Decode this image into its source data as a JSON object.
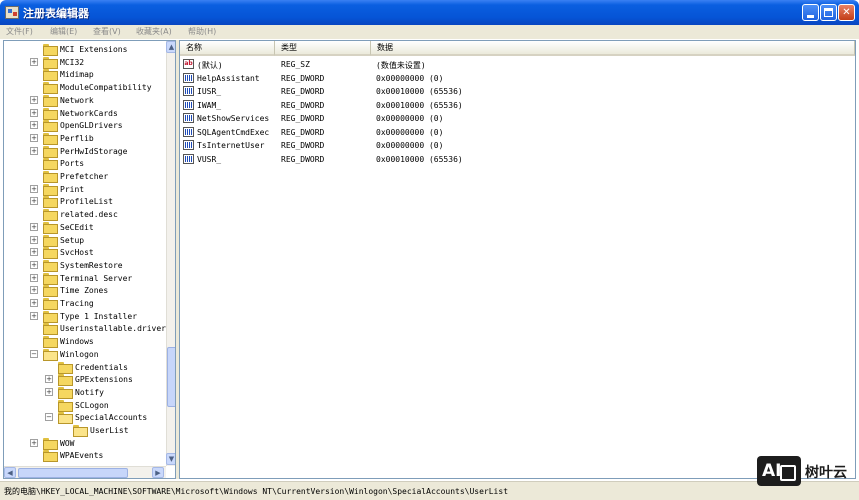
{
  "window": {
    "title": "注册表编辑器",
    "minimize_label": "",
    "maximize_label": "",
    "close_label": "✕"
  },
  "menu": [
    "文件(F)",
    "编辑(E)",
    "查看(V)",
    "收藏夹(A)",
    "帮助(H)"
  ],
  "tree": {
    "items": [
      {
        "label": "MCI Extensions",
        "depth": 0,
        "expander": "",
        "open": false
      },
      {
        "label": "MCI32",
        "depth": 0,
        "expander": "+",
        "open": false
      },
      {
        "label": "Midimap",
        "depth": 0,
        "expander": "",
        "open": false
      },
      {
        "label": "ModuleCompatibility",
        "depth": 0,
        "expander": "",
        "open": false
      },
      {
        "label": "Network",
        "depth": 0,
        "expander": "+",
        "open": false
      },
      {
        "label": "NetworkCards",
        "depth": 0,
        "expander": "+",
        "open": false
      },
      {
        "label": "OpenGLDrivers",
        "depth": 0,
        "expander": "+",
        "open": false
      },
      {
        "label": "Perflib",
        "depth": 0,
        "expander": "+",
        "open": false
      },
      {
        "label": "PerHwIdStorage",
        "depth": 0,
        "expander": "+",
        "open": false
      },
      {
        "label": "Ports",
        "depth": 0,
        "expander": "",
        "open": false
      },
      {
        "label": "Prefetcher",
        "depth": 0,
        "expander": "",
        "open": false
      },
      {
        "label": "Print",
        "depth": 0,
        "expander": "+",
        "open": false
      },
      {
        "label": "ProfileList",
        "depth": 0,
        "expander": "+",
        "open": false
      },
      {
        "label": "related.desc",
        "depth": 0,
        "expander": "",
        "open": false
      },
      {
        "label": "SeCEdit",
        "depth": 0,
        "expander": "+",
        "open": false
      },
      {
        "label": "Setup",
        "depth": 0,
        "expander": "+",
        "open": false
      },
      {
        "label": "SvcHost",
        "depth": 0,
        "expander": "+",
        "open": false
      },
      {
        "label": "SystemRestore",
        "depth": 0,
        "expander": "+",
        "open": false
      },
      {
        "label": "Terminal Server",
        "depth": 0,
        "expander": "+",
        "open": false
      },
      {
        "label": "Time Zones",
        "depth": 0,
        "expander": "+",
        "open": false
      },
      {
        "label": "Tracing",
        "depth": 0,
        "expander": "+",
        "open": false
      },
      {
        "label": "Type 1 Installer",
        "depth": 0,
        "expander": "+",
        "open": false
      },
      {
        "label": "Userinstallable.drivers",
        "depth": 0,
        "expander": "",
        "open": false
      },
      {
        "label": "Windows",
        "depth": 0,
        "expander": "",
        "open": false
      },
      {
        "label": "Winlogon",
        "depth": 0,
        "expander": "−",
        "open": true
      },
      {
        "label": "Credentials",
        "depth": 1,
        "expander": "",
        "open": false
      },
      {
        "label": "GPExtensions",
        "depth": 1,
        "expander": "+",
        "open": false
      },
      {
        "label": "Notify",
        "depth": 1,
        "expander": "+",
        "open": false
      },
      {
        "label": "SCLogon",
        "depth": 1,
        "expander": "",
        "open": false
      },
      {
        "label": "SpecialAccounts",
        "depth": 1,
        "expander": "−",
        "open": true
      },
      {
        "label": "UserList",
        "depth": 2,
        "expander": "",
        "open": true
      },
      {
        "label": "WOW",
        "depth": 0,
        "expander": "+",
        "open": false
      },
      {
        "label": "WPAEvents",
        "depth": 0,
        "expander": "",
        "open": false
      }
    ]
  },
  "list": {
    "columns": [
      "名称",
      "类型",
      "数据"
    ],
    "rows": [
      {
        "icon": "string-value-icon",
        "name": "(默认)",
        "type": "REG_SZ",
        "data": "(数值未设置)"
      },
      {
        "icon": "binary-value-icon",
        "name": "HelpAssistant",
        "type": "REG_DWORD",
        "data": "0x00000000  (0)"
      },
      {
        "icon": "binary-value-icon",
        "name": "IUSR_",
        "type": "REG_DWORD",
        "data": "0x00010000  (65536)"
      },
      {
        "icon": "binary-value-icon",
        "name": "IWAM_",
        "type": "REG_DWORD",
        "data": "0x00010000  (65536)"
      },
      {
        "icon": "binary-value-icon",
        "name": "NetShowServices",
        "type": "REG_DWORD",
        "data": "0x00000000  (0)"
      },
      {
        "icon": "binary-value-icon",
        "name": "SQLAgentCmdExec",
        "type": "REG_DWORD",
        "data": "0x00000000  (0)"
      },
      {
        "icon": "binary-value-icon",
        "name": "TsInternetUser",
        "type": "REG_DWORD",
        "data": "0x00000000  (0)"
      },
      {
        "icon": "binary-value-icon",
        "name": "VUSR_",
        "type": "REG_DWORD",
        "data": "0x00010000  (65536)"
      }
    ]
  },
  "status": {
    "path": "我的电脑\\HKEY_LOCAL_MACHINE\\SOFTWARE\\Microsoft\\Windows NT\\CurrentVersion\\Winlogon\\SpecialAccounts\\UserList"
  },
  "watermark": {
    "logo": "AI",
    "text": "树叶云"
  }
}
